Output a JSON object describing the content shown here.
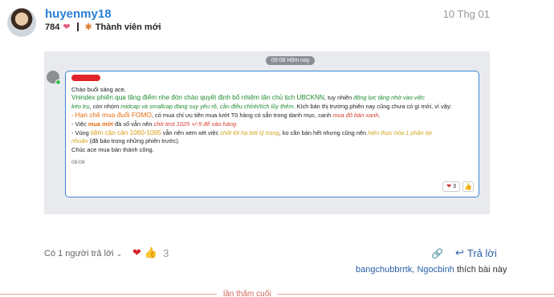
{
  "post": {
    "username": "huyenmy18",
    "date": "10 Thg 01",
    "likes_count": "784",
    "flair_title": "Thành viên mới"
  },
  "screenshot": {
    "time_pill": "09:08 Hôm nay",
    "greeting": "Chào buổi sáng ace,",
    "p1_highlight": "Vnindex phiên qua tăng điểm nhẹ đón chào quyết định bổ nhiệm tân chủ tịch UBCKNN",
    "p1_rest": ", tuy nhiên ",
    "p1_italic": "động lực tăng nhờ vào việc",
    "p2_italic1": "kéo trụ",
    "p2_text1": ", còn nhóm ",
    "p2_italic2": "midcap và smallcap đang suy yếu rõ, cần điều chỉnh/tích lũy thêm.",
    "p2_text2": " Kích bản thị trường phiên nay cũng chưa có gì mới, vì vậy:",
    "b1_prefix": "- ",
    "b1_bold": "Hạn chế mua đuổi FOMO",
    "b1_text": ", có mua chỉ ưu tiên mua lướt T0 hàng có sẵn trong danh mục, canh ",
    "b1_italic": "mua đỏ bán xanh",
    "b1_end": ".",
    "b2_prefix": "- Việc ",
    "b2_bold": "mua mới",
    "b2_text": " đà số vẫn nên ",
    "b2_italic": "chờ test 1025 +/-5 để vào hàng.",
    "b3_prefix": "- Vùng ",
    "b3_bold": "tiệm cận cản 1060-1065",
    "b3_text": " vẫn nên xem xét việc ",
    "b3_italic1": "chốt lời hạ bớt tỷ trọng",
    "b3_text2": ", ko cần bán hết nhưng cũng nên ",
    "b3_italic2": "hiện thực hóa 1 phần lợi",
    "b4_italic": "nhuận",
    "b4_text": " (đã báo trong những phiên trước).",
    "closing": "Chúc ace mua bán thành công.",
    "timestamp": "09:08",
    "reaction_count": "3"
  },
  "footer": {
    "replies": "Có 1 người trả lời",
    "reaction_count": "3",
    "reply_label": "Trả lời",
    "liker1": "bangchubbrrtk",
    "liker_sep": ", ",
    "liker2": "Ngocbinh",
    "likers_suffix": " thích bài này",
    "last_visit": "lần thăm cuối"
  }
}
